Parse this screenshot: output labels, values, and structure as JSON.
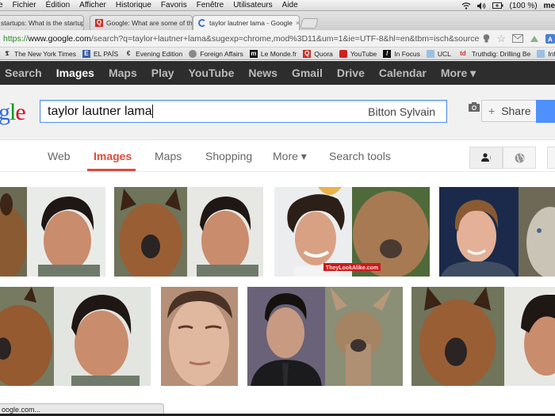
{
  "os_menubar": {
    "items": [
      "e",
      "Fichier",
      "Édition",
      "Afficher",
      "Historique",
      "Favoris",
      "Fenêtre",
      "Utilisateurs",
      "Aide"
    ],
    "battery_text": "(100 %)",
    "user_text": "me"
  },
  "browser": {
    "tabs": [
      {
        "title": "startups: What is the startup",
        "favicon": "quora-icon"
      },
      {
        "title": "Google: What are some of th",
        "favicon": "quora-icon"
      },
      {
        "title": "taylor lautner lama - Google",
        "favicon": "loading-icon",
        "active": true
      }
    ],
    "close_glyph": "×",
    "url": {
      "scheme": "https://",
      "host": "www.google.com",
      "rest": "/search?q=taylor+lautner+lama&sugexp=chrome,mod%3D11&um=1&ie=UTF-8&hl=en&tbm=isch&source=og&sa=N..."
    },
    "bookmarks": [
      {
        "label": "The New York Times",
        "icon": "nyt-icon"
      },
      {
        "label": "EL PAÍS",
        "icon": "elpais-icon"
      },
      {
        "label": "Evening Edition",
        "icon": "evening-edition-icon"
      },
      {
        "label": "Foreign Affairs",
        "icon": "foreign-affairs-icon"
      },
      {
        "label": "Le Monde.fr",
        "icon": "lemonde-icon"
      },
      {
        "label": "Quora",
        "icon": "quora-icon"
      },
      {
        "label": "YouTube",
        "icon": "youtube-icon"
      },
      {
        "label": "In Focus",
        "icon": "infocus-icon"
      },
      {
        "label": "UCL",
        "icon": "folder-icon"
      },
      {
        "label": "Truthdig: Drilling Be",
        "icon": "truthdig-icon"
      },
      {
        "label": "Infor",
        "icon": "folder-icon"
      }
    ],
    "status_text": "oogle.com..."
  },
  "google_bar": {
    "items": [
      "Search",
      "Images",
      "Maps",
      "Play",
      "YouTube",
      "News",
      "Gmail",
      "Drive",
      "Calendar",
      "More ▾"
    ],
    "active_index": 1
  },
  "search": {
    "query": "taylor lautner lama",
    "user_name": "Bitton Sylvain",
    "share_label": "Share",
    "share_plus": "+"
  },
  "search_tabs": {
    "items": [
      "Web",
      "Images",
      "Maps",
      "Shopping",
      "More ▾",
      "Search tools"
    ],
    "active_index": 1
  },
  "results": {
    "images": [
      {
        "desc": "alpaca and Taylor Lautner (cropped)"
      },
      {
        "desc": "alpaca next to Taylor Lautner"
      },
      {
        "desc": "young Taylor Lautner next to fluffy alpaca",
        "watermark": "TheyLookAlike.com"
      },
      {
        "desc": "Mark Zuckerberg next to seal"
      },
      {
        "desc": "alpaca and Taylor Lautner"
      },
      {
        "desc": "morphed face"
      },
      {
        "desc": "Taylor Lautner in suit next to llama"
      },
      {
        "desc": "alpaca next to Taylor Lautner (cropped)"
      }
    ]
  },
  "colors": {
    "accent_red": "#dd4b39",
    "google_blue": "#4d90fe",
    "bar_dark": "#2d2d2d"
  }
}
